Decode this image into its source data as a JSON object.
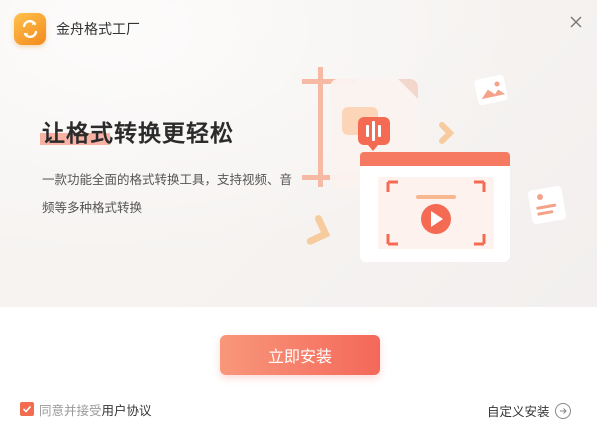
{
  "window": {
    "title": "金舟格式工厂",
    "close_icon": "close-icon"
  },
  "hero": {
    "headline": "让格式转换更轻松",
    "subtitle": "一款功能全面的格式转换工具，支持视频、音频等多种格式转换"
  },
  "actions": {
    "install_label": "立即安装",
    "custom_install_label": "自定义安装"
  },
  "agreement": {
    "checked": true,
    "prefix": "同意并接受",
    "link_label": "用户协议"
  },
  "colors": {
    "accent": "#f4685a",
    "accent_light": "#f8977b",
    "logo": "#f5a623"
  }
}
